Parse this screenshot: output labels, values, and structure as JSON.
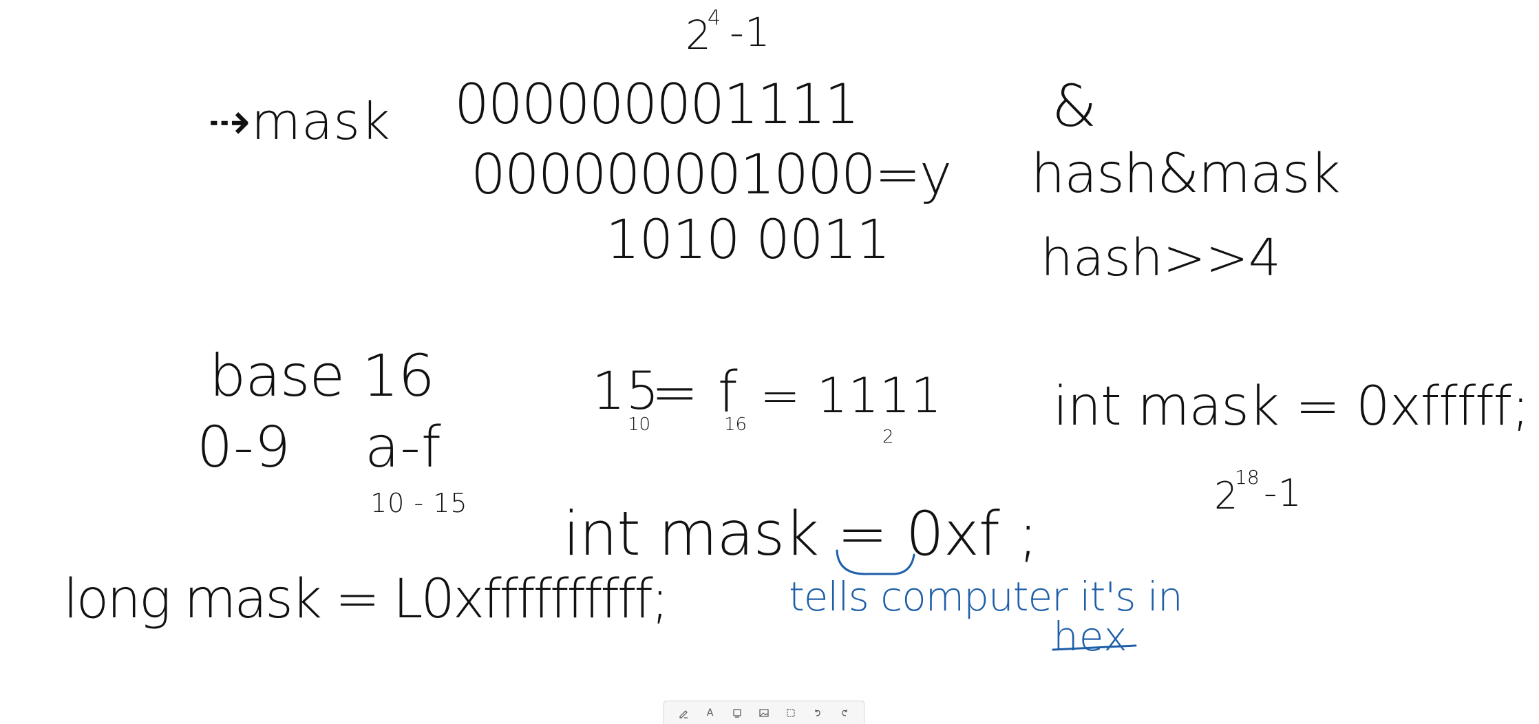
{
  "whiteboard": {
    "top_exponent_base": "2",
    "top_exponent_power": "4",
    "top_exponent_suffix": "-1",
    "arrow_label": "⇢mask",
    "binary_mask": "000000001111",
    "binary_y": "000000001000=y",
    "binary_byte": "1010 0011",
    "ampersand": "&",
    "hash_and_mask": "hash&mask",
    "hash_shift": "hash>>4",
    "base_label": "base 16",
    "digits_range": "0-9",
    "letters_range": "a-f",
    "letters_values": "10 - 15",
    "conversion_base10": "15",
    "conversion_base10_sub": "10",
    "conversion_eq_f": "= f",
    "conversion_base16_sub": "16",
    "conversion_eq_bin": "= 1111",
    "conversion_base2_sub": "2",
    "int_mask_long": "int mask = 0xfffff;",
    "exp18_base": "2",
    "exp18_power": "18",
    "exp18_suffix": "-1",
    "int_mask_f": "int mask = 0xf ;",
    "long_mask": "long mask = L0xffffffffff;",
    "note_line1": "tells computer it's in",
    "note_line2": "hex"
  },
  "colors": {
    "ink": "#111111",
    "note_ink": "#1f5fa8",
    "background": "#ffffff"
  },
  "toolbar": {
    "tools": [
      {
        "name": "pen-tool",
        "icon": "pen-icon"
      },
      {
        "name": "text-tool",
        "icon": "text-icon",
        "glyph": "A"
      },
      {
        "name": "shape-tool",
        "icon": "shape-icon"
      },
      {
        "name": "image-tool",
        "icon": "image-icon"
      },
      {
        "name": "select-tool",
        "icon": "select-icon"
      },
      {
        "name": "undo-tool",
        "icon": "undo-icon"
      },
      {
        "name": "redo-tool",
        "icon": "redo-icon"
      }
    ]
  }
}
